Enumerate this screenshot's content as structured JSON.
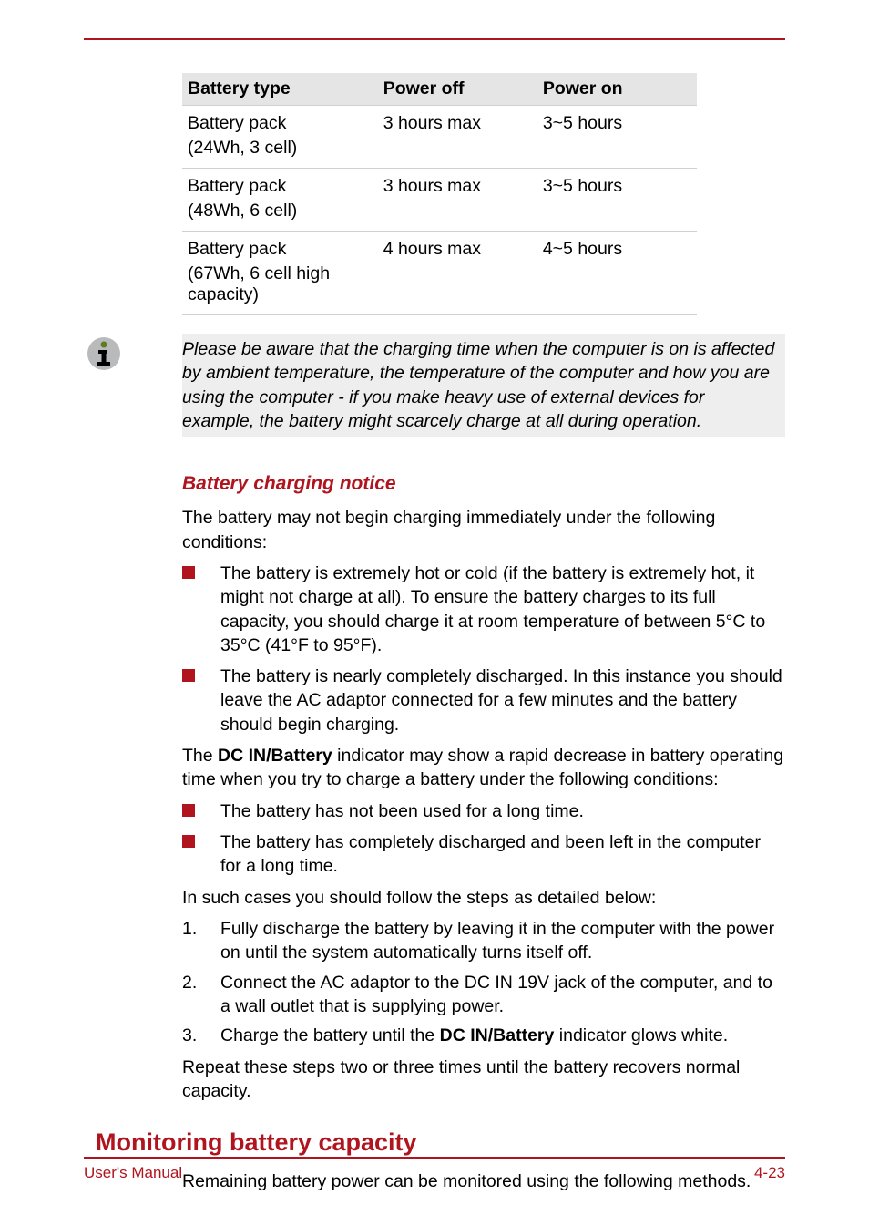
{
  "table": {
    "headers": {
      "c1": "Battery type",
      "c2": "Power off",
      "c3": "Power on"
    },
    "rows": [
      {
        "c1a": "Battery pack",
        "c1b": "(24Wh, 3 cell)",
        "c2": "3 hours max",
        "c3": "3~5 hours"
      },
      {
        "c1a": "Battery pack",
        "c1b": "(48Wh, 6 cell)",
        "c2": "3 hours max",
        "c3": "3~5 hours"
      },
      {
        "c1a": "Battery pack",
        "c1b": "(67Wh, 6 cell high capacity)",
        "c2": "4 hours max",
        "c3": "4~5 hours"
      }
    ]
  },
  "note": "Please be aware that the charging time when the computer is on is affected by ambient temperature, the temperature of the computer and how you are using the computer - if you make heavy use of external devices for example, the battery might scarcely charge at all during operation.",
  "sec1": {
    "heading": "Battery charging notice",
    "intro": "The battery may not begin charging immediately under the following conditions:",
    "bullets1": [
      "The battery is extremely hot or cold (if the battery is extremely hot, it might not charge at all). To ensure the battery charges to its full capacity, you should charge it at room temperature of between 5°C to 35°C (41°F to 95°F).",
      "The battery is nearly completely discharged. In this instance you should leave the AC adaptor connected for a few minutes and the battery should begin charging."
    ],
    "p2a": "The ",
    "p2b": "DC IN/Battery",
    "p2c": " indicator may show a rapid decrease in battery operating time when you try to charge a battery under the following conditions:",
    "bullets2": [
      "The battery has not been used for a long time.",
      "The battery has completely discharged and been left in the computer for a long time."
    ],
    "p3": "In such cases you should follow the steps as detailed below:",
    "steps": [
      "Fully discharge the battery by leaving it in the computer with the power on until the system automatically turns itself off.",
      "Connect the AC adaptor to the DC IN 19V jack of the computer, and to a wall outlet that is supplying power."
    ],
    "step3a": "Charge the battery until the ",
    "step3b": "DC IN/Battery",
    "step3c": " indicator glows white.",
    "p4": "Repeat these steps two or three times until the battery recovers normal capacity."
  },
  "sec2": {
    "heading": "Monitoring battery capacity",
    "p1": "Remaining battery power can be monitored using the following methods."
  },
  "footer": {
    "left": "User's Manual",
    "right": "4-23"
  }
}
